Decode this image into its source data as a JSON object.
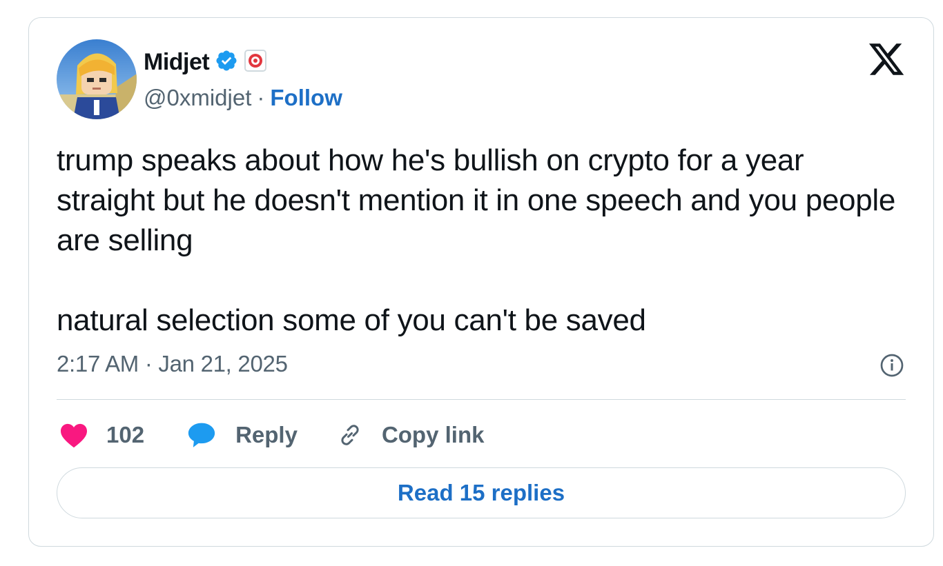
{
  "author": {
    "display_name": "Midjet",
    "handle": "@0xmidjet",
    "separator": "·",
    "follow_label": "Follow",
    "verified_icon": "verified-badge-icon",
    "affiliate_icon": "affiliate-badge-icon"
  },
  "tweet": {
    "text": "trump speaks about how he's bullish on crypto for a year straight but he doesn't mention it in one speech and you people are selling\n\nnatural selection some of you can't be saved",
    "timestamp": "2:17 AM · Jan 21, 2025"
  },
  "actions": {
    "like_count": "102",
    "reply_label": "Reply",
    "copy_link_label": "Copy link"
  },
  "read_replies_label": "Read 15 replies",
  "colors": {
    "like": "#f91880",
    "reply_icon": "#1d9bf0",
    "link": "#1d6fc6",
    "verified": "#1d9bf0",
    "text": "#0f1419",
    "secondary": "#536471",
    "border": "#cfd9de"
  }
}
